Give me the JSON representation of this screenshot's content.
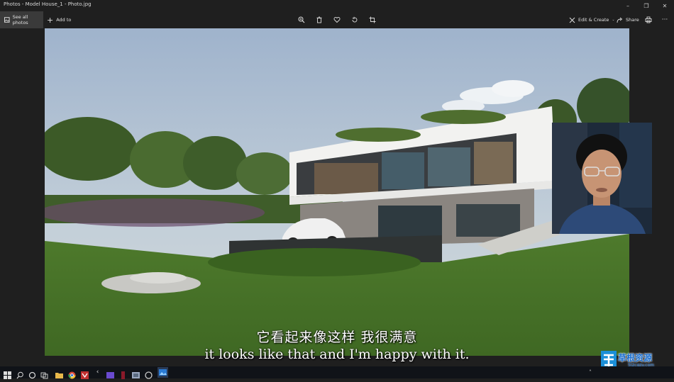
{
  "window": {
    "title": "Photos - Model House_1 - Photo.jpg",
    "controls": [
      "minimize-icon",
      "maximize-icon",
      "close-icon"
    ]
  },
  "toolbar": {
    "see_all_photos": "See all photos",
    "add_to": "Add to",
    "edit_create": "Edit & Create",
    "share": "Share",
    "icons": [
      "zoom-in-icon",
      "delete-icon",
      "favorite-heart-icon",
      "rotate-icon",
      "crop-icon",
      "print-icon",
      "more-icon"
    ]
  },
  "subtitles": {
    "chinese": "它看起来像这样 我很满意",
    "english": "it looks like that and I'm happy with it."
  },
  "watermark": {
    "text": "草根资源",
    "url": "5l2cgzy.com"
  },
  "taskbar": {
    "icons": [
      "windows-start-icon",
      "search-icon",
      "cortana-icon",
      "task-view-icon",
      "file-explorer-icon",
      "chrome-icon",
      "app-icon",
      "app-icon",
      "app-icon",
      "app-icon",
      "app-icon",
      "app-icon",
      "photos-icon"
    ],
    "tray": [
      "chevron-up-icon",
      "notification-icon"
    ]
  },
  "colors": {
    "background": "#1f1f1f",
    "taskbar": "#101318",
    "selected_toolbar_item": "#3a3a3a"
  }
}
